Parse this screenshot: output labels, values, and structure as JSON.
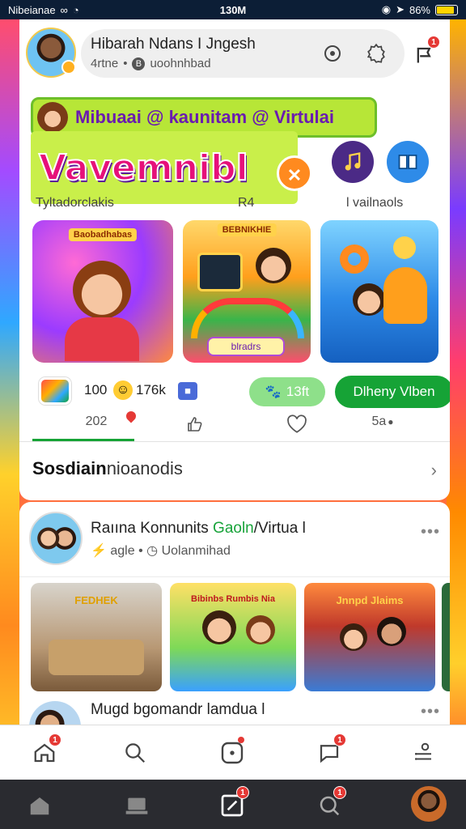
{
  "status_bar": {
    "carrier": "Nibeianae",
    "time": "130M",
    "battery": "86%",
    "battery_level": 0.86
  },
  "profile": {
    "name": "Hibarah Ndans I Jngesh",
    "sub_left": "4rtne",
    "sub_right": "uoohnhbad",
    "bell_badge": "1"
  },
  "banner": {
    "strip_text": "Mibuaai @ kaunitam @ Virtulai",
    "big_text": "Vavemnibl",
    "x_badge": "✕"
  },
  "sections": {
    "left_label": "Tyltadorclakis",
    "mid_label": "R4",
    "right_label": "l vailnaols"
  },
  "thumbs": [
    {
      "tag": "Baobadhabas"
    },
    {
      "tag": "BEBNIKHIE",
      "cta": "blradrs"
    },
    {
      "tag": ""
    }
  ],
  "stats": {
    "text": "100",
    "views": "176k",
    "pill": "13ft",
    "button": "Dlheny Vlben"
  },
  "actions": {
    "count": "202",
    "share": "5a"
  },
  "section_title": {
    "bold": "Sosdiain",
    "light": "nioanodis"
  },
  "post1": {
    "name_a": "Raıına Konnunits",
    "name_green": "Gaoln",
    "name_b": "/Virtua l",
    "sub_a": "agle",
    "sub_b": "Uolanmihad"
  },
  "post_thumbs": [
    {
      "title": "FEDHEK"
    },
    {
      "title": "Bibinbs Rumbis Nia"
    },
    {
      "title": "Jnnpd Jlaims"
    }
  ],
  "post2": {
    "name": "Mugd bgomandr lamdua l"
  },
  "tabbar": {
    "home_badge": "1",
    "msg_badge": "1"
  },
  "sysbar": {
    "edit_badge": "1",
    "search_badge": "1"
  },
  "colors": {
    "accent_green": "#16a336",
    "notif_red": "#e53935"
  }
}
